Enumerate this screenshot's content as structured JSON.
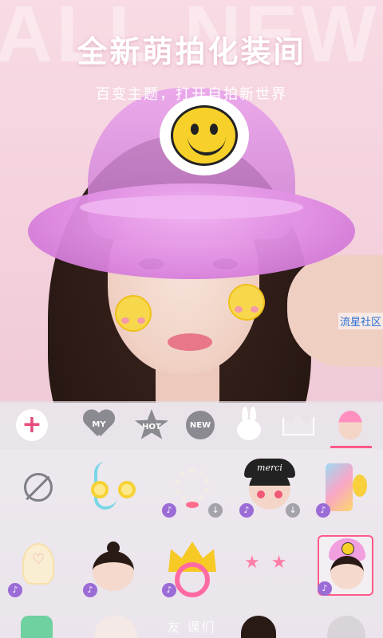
{
  "header": {
    "bg_word": "ALL NEW",
    "headline": "全新萌拍化装间",
    "subline": "百变主题，打开自拍新世界"
  },
  "watermark": "流星社区",
  "categories": {
    "items": [
      {
        "label": "MY"
      },
      {
        "label": "HOT"
      },
      {
        "label": "NEW"
      }
    ],
    "plus": "+"
  },
  "badges": {
    "music": "♪",
    "download": "↓"
  },
  "sticker_glyphs": {
    "cap_text": "merci",
    "stars": "★★"
  },
  "bottom_text": "友 课们"
}
